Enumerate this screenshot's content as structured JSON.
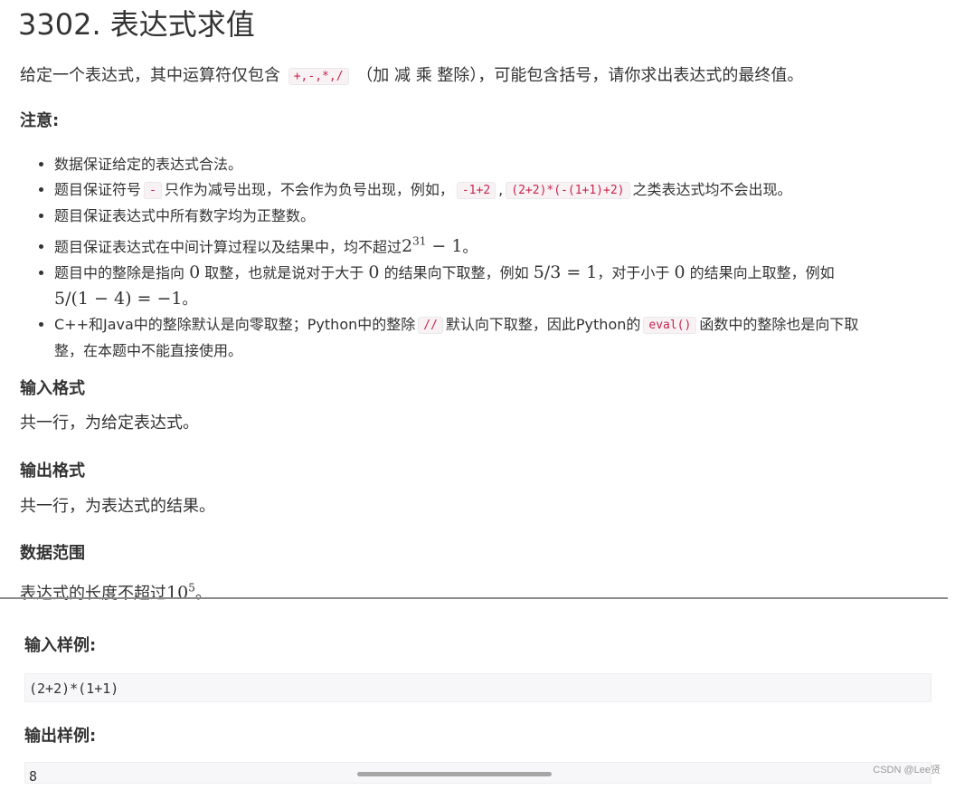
{
  "problem": {
    "title": "3302. 表达式求值",
    "intro_before": "给定一个表达式，其中运算符仅包含",
    "operators": "+,-,*,/",
    "intro_after": "（加 减 乘 整除），可能包含括号，请你求出表达式的最终值。",
    "notes_heading": "注意:",
    "notes": {
      "n1": "数据保证给定的表达式合法。",
      "n2_a": "题目保证符号",
      "n2_code1": "-",
      "n2_b": "只作为减号出现，不会作为负号出现，例如，",
      "n2_code2": "-1+2",
      "n2_comma": ",",
      "n2_code3": "(2+2)*(-(1+1)+2)",
      "n2_c": "之类表达式均不会出现。",
      "n3": "题目保证表达式中所有数字均为正整数。",
      "n4_a": "题目保证表达式在中间计算过程以及结果中，均不超过",
      "n4_base": "2",
      "n4_exp": "31",
      "n4_tail": " − 1",
      "n4_end": "。",
      "n5_a": "题目中的整除是指向",
      "n5_zero1": "0",
      "n5_b": "取整，也就是说对于大于",
      "n5_zero2": "0",
      "n5_c": "的结果向下取整，例如",
      "n5_ex1": "5/3 = 1",
      "n5_d": "，对于小于",
      "n5_zero3": "0",
      "n5_e": "的结果向上取整，例如",
      "n5_ex2": "5/(1 − 4) = −1",
      "n5_end": "。",
      "n6_a": "C++和Java中的整除默认是向零取整；Python中的整除",
      "n6_code1": "//",
      "n6_b": "默认向下取整，因此Python的",
      "n6_code2": "eval()",
      "n6_c": "函数中的整除也是向下取",
      "n6_d": "整，在本题中不能直接使用。"
    },
    "input_heading": "输入格式",
    "input_text": "共一行，为给定表达式。",
    "output_heading": "输出格式",
    "output_text": "共一行，为表达式的结果。",
    "range_heading": "数据范围",
    "range_text": "表达式的长度不超过",
    "range_base": "10",
    "range_exp": "5",
    "range_end": "。"
  },
  "samples": {
    "input_label": "输入样例:",
    "input_value": "(2+2)*(1+1)",
    "output_label": "输出样例:",
    "output_value": "8"
  },
  "watermark": "CSDN @Lee贤"
}
